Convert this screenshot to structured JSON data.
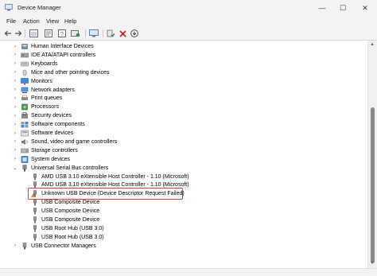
{
  "window": {
    "title": "Device Manager",
    "controls": [
      "minimize",
      "maximize",
      "close"
    ]
  },
  "menu": [
    "File",
    "Action",
    "View",
    "Help"
  ],
  "toolbar": {
    "icons": [
      "back-icon",
      "forward-icon",
      "show-hidden-icon",
      "properties-icon",
      "help-icon",
      "update-driver-icon",
      "scan-hardware-icon",
      "enable-device-icon",
      "uninstall-icon",
      "disable-icon"
    ]
  },
  "tree": {
    "categories": [
      {
        "label": "Human Interface Devices",
        "icon": "hid-icon"
      },
      {
        "label": "IDE ATA/ATAPI controllers",
        "icon": "ide-icon"
      },
      {
        "label": "Keyboards",
        "icon": "keyboard-icon"
      },
      {
        "label": "Mice and other pointing devices",
        "icon": "mouse-icon"
      },
      {
        "label": "Monitors",
        "icon": "monitor-icon"
      },
      {
        "label": "Network adapters",
        "icon": "network-icon"
      },
      {
        "label": "Print queues",
        "icon": "printer-icon"
      },
      {
        "label": "Processors",
        "icon": "processor-icon"
      },
      {
        "label": "Security devices",
        "icon": "security-icon"
      },
      {
        "label": "Software components",
        "icon": "software-components-icon"
      },
      {
        "label": "Software devices",
        "icon": "software-devices-icon"
      },
      {
        "label": "Sound, video and game controllers",
        "icon": "sound-icon"
      },
      {
        "label": "Storage controllers",
        "icon": "storage-icon"
      },
      {
        "label": "System devices",
        "icon": "system-icon"
      }
    ],
    "usb": {
      "label": "Universal Serial Bus controllers",
      "children": [
        {
          "label": "AMD USB 3.10 eXtensible Host Controller - 1.10 (Microsoft)",
          "icon": "usb-icon"
        },
        {
          "label": "AMD USB 3.10 eXtensible Host Controller - 1.10 (Microsoft)",
          "icon": "usb-icon"
        },
        {
          "label": "Unknown USB Device (Device Descriptor Request Failed)",
          "icon": "warning-usb-icon"
        },
        {
          "label": "USB Composite Device",
          "icon": "usb-icon"
        },
        {
          "label": "USB Composite Device",
          "icon": "usb-icon"
        },
        {
          "label": "USB Composite Device",
          "icon": "usb-icon"
        },
        {
          "label": "USB Root Hub (USB 3.0)",
          "icon": "usb-icon"
        },
        {
          "label": "USB Root Hub (USB 3.0)",
          "icon": "usb-icon"
        }
      ]
    },
    "connectors": {
      "label": "USB Connector Managers",
      "icon": "usb-connector-icon"
    }
  },
  "colors": {
    "highlight": "#e03a3a",
    "accent": "#1e6fd0",
    "warning": "#f2b01e"
  }
}
